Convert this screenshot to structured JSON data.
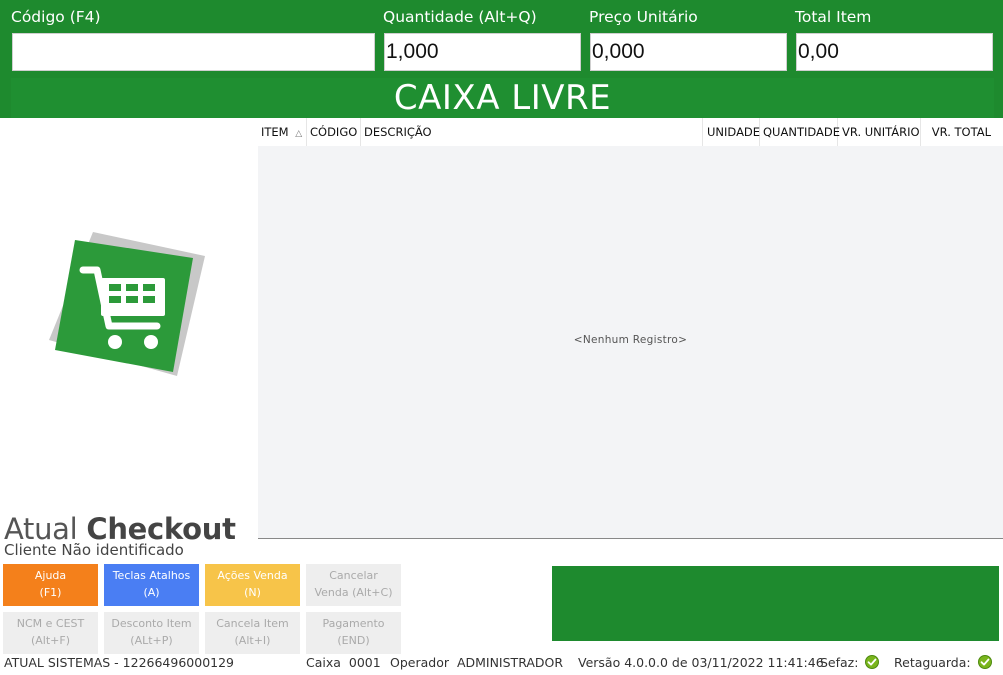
{
  "header": {
    "codigo": {
      "label": "Código (F4)",
      "value": ""
    },
    "quantidade": {
      "label": "Quantidade (Alt+Q)",
      "value": "1,000"
    },
    "preco": {
      "label": "Preço Unitário",
      "value": "0,000"
    },
    "total": {
      "label": "Total Item",
      "value": "0,00"
    },
    "status": "CAIXA LIVRE"
  },
  "logo": {
    "brand_light": "Atual",
    "brand_bold": "Checkout",
    "icon": "shopping-cart-icon"
  },
  "grid": {
    "columns": [
      "ITEM",
      "CÓDIGO",
      "DESCRIÇÃO",
      "UNIDADE",
      "QUANTIDADE",
      "VR. UNITÁRIO",
      "VR. TOTAL"
    ],
    "sort_indicator": "△",
    "empty_message": "<Nenhum Registro>"
  },
  "client": "Cliente Não identificado",
  "buttons": [
    {
      "line1": "Ajuda",
      "line2": "(F1)"
    },
    {
      "line1": "Teclas Atalhos",
      "line2": "(A)"
    },
    {
      "line1": "Ações Venda",
      "line2": "(N)"
    },
    {
      "line1": "Cancelar",
      "line2": "Venda (Alt+C)"
    },
    {
      "line1": "NCM e CEST",
      "line2": "(Alt+F)"
    },
    {
      "line1": "Desconto Item",
      "line2": "(ALt+P)"
    },
    {
      "line1": "Cancela Item",
      "line2": "(Alt+I)"
    },
    {
      "line1": "Pagamento",
      "line2": "(END)"
    }
  ],
  "footer": {
    "company": "ATUAL SISTEMAS - 12266496000129",
    "caixa_label": "Caixa",
    "caixa_value": "0001",
    "operador_label": "Operador",
    "operador_value": "ADMINISTRADOR",
    "versao": "Versão 4.0.0.0 de 03/11/2022 11:41:46",
    "sefaz": "Sefaz:",
    "retaguarda": "Retaguarda:"
  },
  "colors": {
    "primary_green": "#1e8a2e",
    "orange": "#f4801b",
    "blue": "#4a7ef3",
    "yellow": "#f7c449"
  }
}
